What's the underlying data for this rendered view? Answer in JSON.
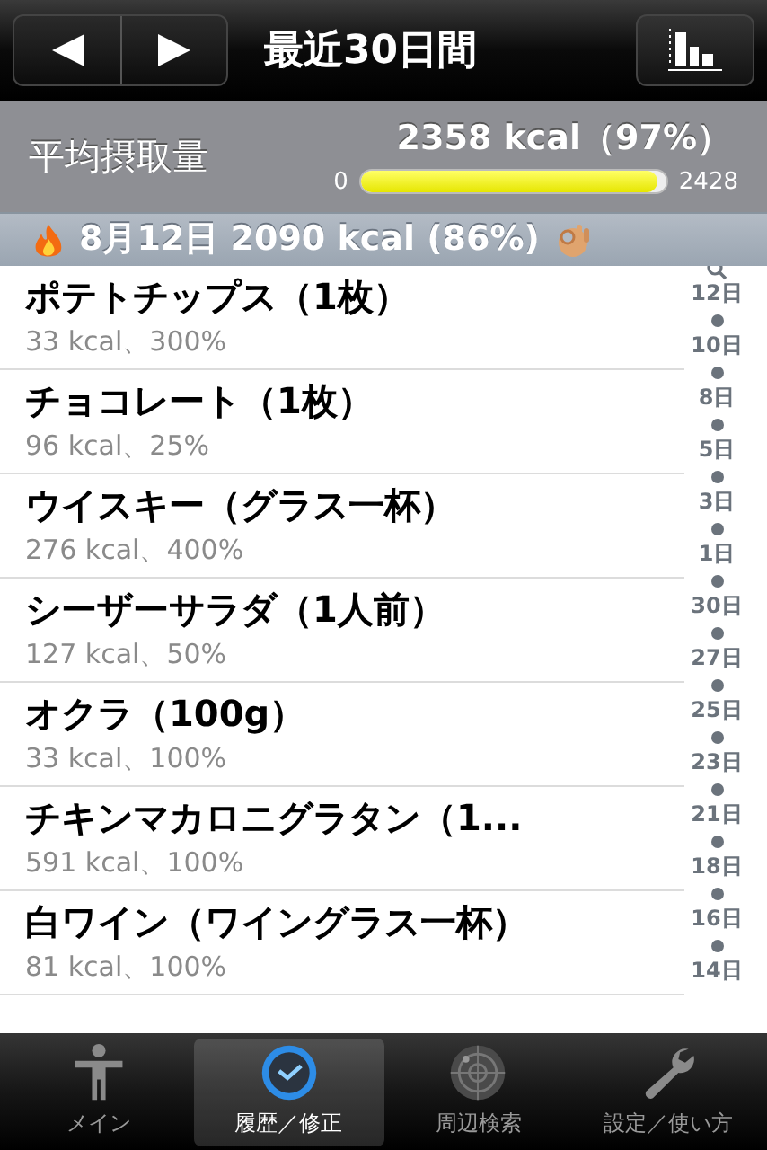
{
  "nav": {
    "title": "最近30日間"
  },
  "summary": {
    "label": "平均摂取量",
    "value": "2358 kcal（97%）",
    "min": "0",
    "max": "2428",
    "level": 0.97
  },
  "section": {
    "title": "8月12日  2090 kcal (86%)"
  },
  "entries": [
    {
      "name": "ポテトチップス（1枚）",
      "detail": "33 kcal、300%"
    },
    {
      "name": "チョコレート（1枚）",
      "detail": "96 kcal、25%"
    },
    {
      "name": "ウイスキー（グラス一杯）",
      "detail": "276 kcal、400%"
    },
    {
      "name": "シーザーサラダ（1人前）",
      "detail": "127 kcal、50%"
    },
    {
      "name": "オクラ（100g）",
      "detail": "33 kcal、100%"
    },
    {
      "name": "チキンマカロニグラタン（1...",
      "detail": "591 kcal、100%"
    },
    {
      "name": "白ワイン（ワイングラス一杯）",
      "detail": "81 kcal、100%"
    }
  ],
  "index": [
    "12日",
    "10日",
    "8日",
    "5日",
    "3日",
    "1日",
    "30日",
    "27日",
    "25日",
    "23日",
    "21日",
    "18日",
    "16日",
    "14日"
  ],
  "tabs": [
    {
      "label": "メイン",
      "kind": "person",
      "selected": false
    },
    {
      "label": "履歴／修正",
      "kind": "clock",
      "selected": true
    },
    {
      "label": "周辺検索",
      "kind": "radar",
      "selected": false
    },
    {
      "label": "設定／使い方",
      "kind": "wrench",
      "selected": false
    }
  ]
}
